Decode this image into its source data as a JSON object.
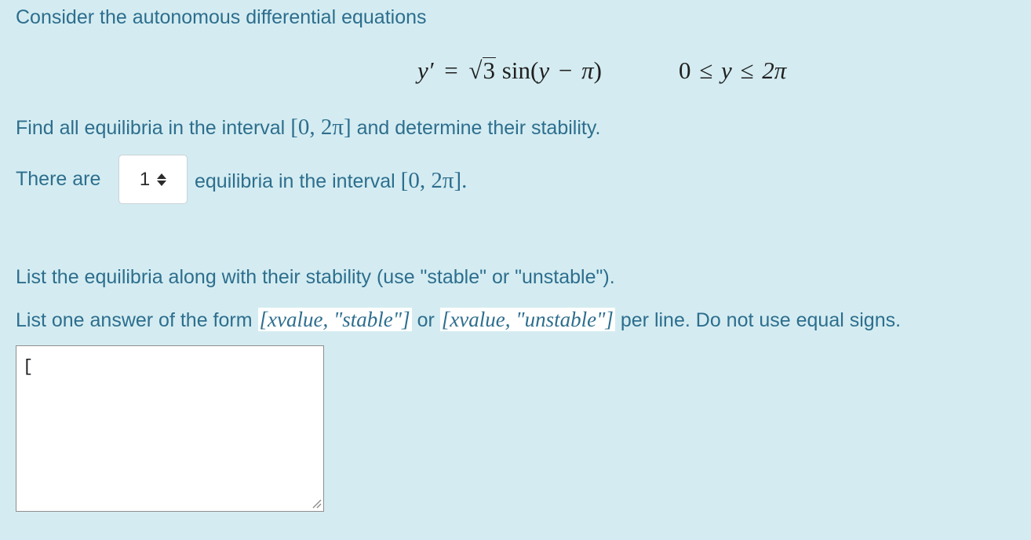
{
  "intro": "Consider the autonomous differential equations",
  "equation": {
    "lhs": "y′",
    "eq": "=",
    "coef_radicand": "3",
    "func": "sin",
    "arg_open": "(",
    "arg_var": "y",
    "arg_minus": "−",
    "arg_pi": "π",
    "arg_close": ")",
    "domain_lo": "0",
    "domain_le1": "≤",
    "domain_var": "y",
    "domain_le2": "≤",
    "domain_hi": "2π"
  },
  "task": {
    "prefix": "Find all equilibria in the interval",
    "interval": "[0, 2π]",
    "suffix": "and determine their stability."
  },
  "count_row": {
    "prefix": "There are",
    "selected": "1",
    "suffix": "equilibria in the interval",
    "interval": "[0, 2π]."
  },
  "instructions": {
    "line1": "List the equilibria along with their stability (use \"stable\" or \"unstable\").",
    "line2_prefix": "List one answer of the form",
    "format_stable": "[xvalue, \"stable\"]",
    "line2_or": "or",
    "format_unstable": "[xvalue, \"unstable\"]",
    "line2_suffix": "per line. Do not use equal signs."
  },
  "answer": {
    "value": "["
  }
}
